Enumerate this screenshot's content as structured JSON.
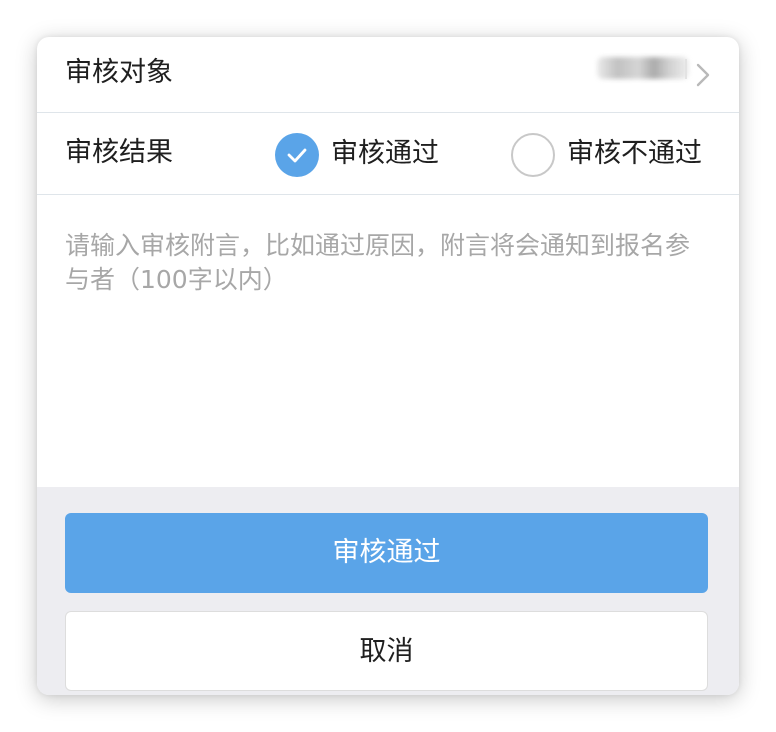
{
  "target_row": {
    "label": "审核对象",
    "value_icon": "blurred-name",
    "chevron_icon": "chevron-right-icon"
  },
  "result_row": {
    "label": "审核结果",
    "options": [
      {
        "label": "审核通过",
        "checked": true,
        "icon": "check-icon"
      },
      {
        "label": "审核不通过",
        "checked": false
      }
    ]
  },
  "memo": {
    "placeholder": "请输入审核附言，比如通过原因，附言将会通知到报名参与者（100字以内）",
    "value": ""
  },
  "actions": {
    "approve_label": "审核通过",
    "cancel_label": "取消"
  },
  "colors": {
    "accent": "#5aa4e8",
    "footer_bg": "#ededf1",
    "placeholder": "#a7a7a7",
    "divider": "#dfe5ea"
  }
}
